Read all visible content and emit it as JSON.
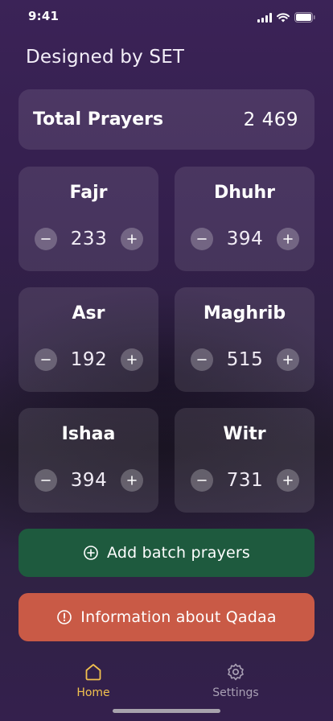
{
  "status_bar": {
    "time": "9:41"
  },
  "brand": "Designed by SET",
  "total": {
    "label": "Total Prayers",
    "value": "2 469"
  },
  "prayers": [
    {
      "name": "Fajr",
      "count": "233"
    },
    {
      "name": "Dhuhr",
      "count": "394"
    },
    {
      "name": "Asr",
      "count": "192"
    },
    {
      "name": "Maghrib",
      "count": "515"
    },
    {
      "name": "Ishaa",
      "count": "394"
    },
    {
      "name": "Witr",
      "count": "731"
    }
  ],
  "actions": {
    "batch_label": "Add batch prayers",
    "info_label": "Information about Qadaa"
  },
  "tabs": {
    "home_label": "Home",
    "settings_label": "Settings",
    "active": "Home"
  },
  "colors": {
    "accent": "#f2c14e",
    "batch_button": "#1e5a3e",
    "info_button": "#c95a46"
  }
}
